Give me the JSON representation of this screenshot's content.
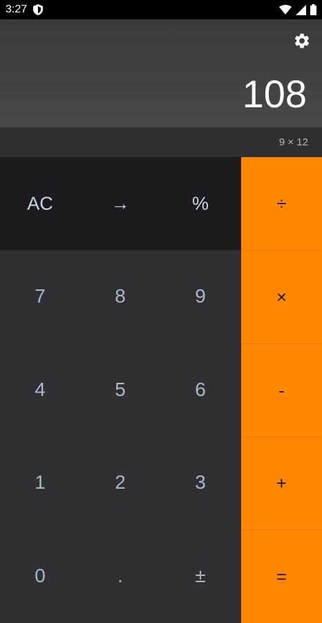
{
  "status_bar": {
    "time": "3:27",
    "icons": [
      "shield-icon",
      "wifi-icon",
      "signal-icon",
      "battery-icon"
    ]
  },
  "display": {
    "result": "108",
    "expression": "9 × 12",
    "settings_icon": "gear-icon"
  },
  "keys": {
    "function_row": [
      "AC",
      "→",
      "%"
    ],
    "numbers": [
      [
        "7",
        "8",
        "9"
      ],
      [
        "4",
        "5",
        "6"
      ],
      [
        "1",
        "2",
        "3"
      ],
      [
        "0",
        ".",
        "±"
      ]
    ],
    "operators": [
      "÷",
      "×",
      "-",
      "+",
      "="
    ]
  },
  "colors": {
    "accent": "#ff8800",
    "function_row_bg": "#1c1c1e",
    "numpad_bg": "#303032",
    "display_bg": "#48484a",
    "key_text": "#a9b6cc"
  }
}
